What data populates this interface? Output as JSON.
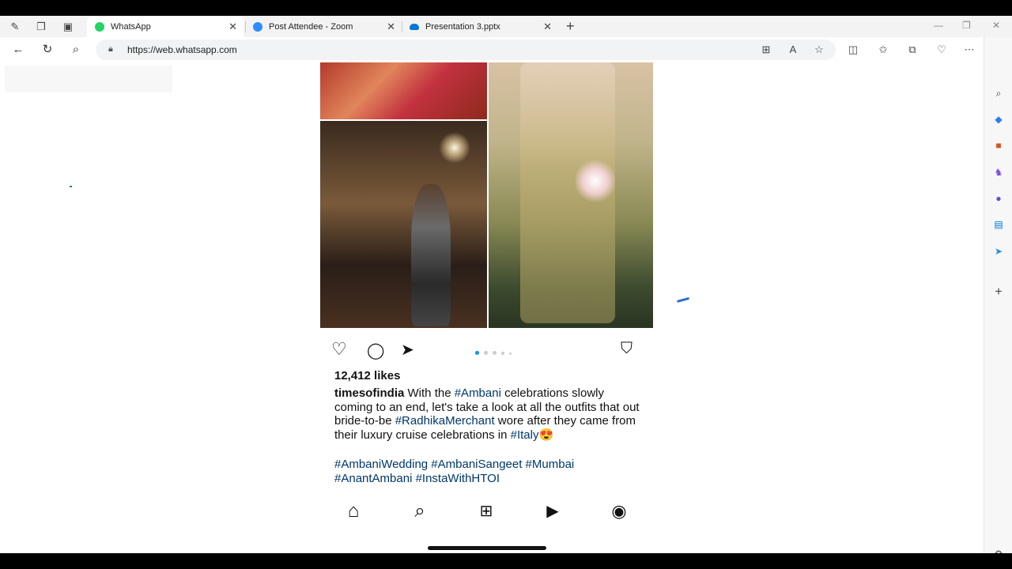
{
  "browser": {
    "tabs": [
      {
        "title": "WhatsApp",
        "icon": "whatsapp-icon",
        "color": "#25d366",
        "active": true
      },
      {
        "title": "Post Attendee - Zoom",
        "icon": "zoom-icon",
        "color": "#2d8cff",
        "active": false
      },
      {
        "title": "Presentation 3.pptx",
        "icon": "onedrive-icon",
        "color": "#0078d4",
        "active": false
      }
    ],
    "url": "https://web.whatsapp.com",
    "new_tab_label": "+"
  },
  "post": {
    "likes": "12,412 likes",
    "username": "timesofindia",
    "caption_parts": [
      {
        "text": " With the ",
        "type": "text"
      },
      {
        "text": "#Ambani",
        "type": "tag"
      },
      {
        "text": " celebrations slowly coming to an end, let's take a look at all the outfits that out bride-to-be ",
        "type": "text"
      },
      {
        "text": "#RadhikaMerchant",
        "type": "tag"
      },
      {
        "text": " wore after they came from their luxury cruise celebrations in ",
        "type": "text"
      },
      {
        "text": "#Italy",
        "type": "tag"
      },
      {
        "text": "😍",
        "type": "text"
      }
    ],
    "hashtags_line1": "#AmbaniWedding #AmbaniSangeet #Mumbai",
    "hashtags_line2": "#AnantAmbani #InstaWithHTOI",
    "carousel_dots": 5,
    "active_dot": 0
  },
  "colors": {
    "accent": "#0095f6",
    "hashtag": "#00376b",
    "whatsapp": "#25d366"
  }
}
